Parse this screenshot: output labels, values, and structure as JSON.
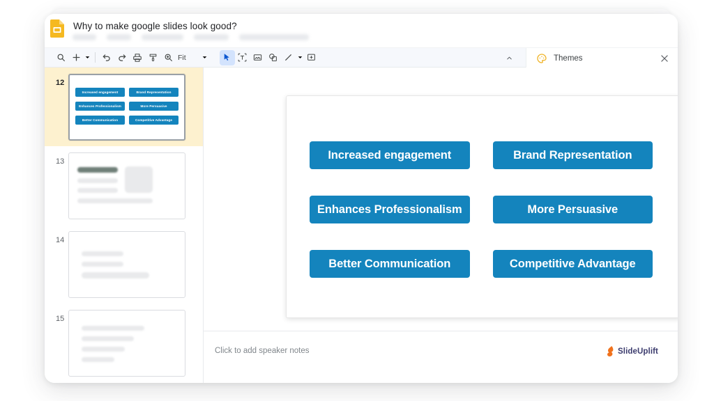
{
  "app": {
    "logo_icon": "google-slides-icon",
    "doc_title": "Why to make google slides look good?",
    "menu_placeholder_count": 5
  },
  "toolbar": {
    "items": [
      {
        "icon": "search-icon",
        "name": "search-tool"
      },
      {
        "icon": "plus-icon",
        "name": "new-slide-button"
      },
      {
        "icon": "caret-down-icon",
        "name": "new-slide-options-caret"
      },
      {
        "icon": "undo-icon",
        "name": "undo-button"
      },
      {
        "icon": "redo-icon",
        "name": "redo-button"
      },
      {
        "icon": "print-icon",
        "name": "print-button"
      },
      {
        "icon": "paint-format-icon",
        "name": "paint-format-button"
      },
      {
        "icon": "zoom-icon",
        "name": "zoom-button"
      }
    ],
    "fit_label": "Fit",
    "fit_caret_icon": "caret-down-icon",
    "tools": [
      {
        "icon": "cursor-icon",
        "name": "select-tool",
        "active": true
      },
      {
        "icon": "textbox-icon",
        "name": "text-box-tool",
        "active": false
      },
      {
        "icon": "image-icon",
        "name": "insert-image-tool",
        "active": false
      },
      {
        "icon": "shape-icon",
        "name": "insert-shape-tool",
        "active": false
      },
      {
        "icon": "line-icon",
        "name": "insert-line-tool",
        "active": false
      },
      {
        "icon": "caret-down-icon",
        "name": "line-options-caret",
        "active": false
      },
      {
        "icon": "comment-icon",
        "name": "add-comment-tool",
        "active": false
      }
    ],
    "collapse_icon": "chevron-up-icon"
  },
  "themes_panel": {
    "icon": "palette-icon",
    "title": "Themes",
    "close_icon": "close-icon"
  },
  "filmstrip": {
    "slides": [
      {
        "number": "12",
        "selected": true,
        "type": "buttons",
        "buttons": [
          "Increased engagement",
          "Brand Representation",
          "Enhances Professionalism",
          "More Persuasive",
          "Better Communication",
          "Competitive Advantage"
        ]
      },
      {
        "number": "13",
        "selected": false,
        "type": "placeholder-title-image"
      },
      {
        "number": "14",
        "selected": false,
        "type": "placeholder-lines-3"
      },
      {
        "number": "15",
        "selected": false,
        "type": "placeholder-lines-4"
      }
    ]
  },
  "slide": {
    "buttons": [
      "Increased engagement",
      "Brand Representation",
      "Enhances Professionalism",
      "More Persuasive",
      "Better Communication",
      "Competitive Advantage"
    ],
    "button_color": "#1484bd",
    "button_text_color": "#ffffff",
    "background": "#ffffff"
  },
  "notes": {
    "placeholder": "Click to add speaker notes"
  },
  "branding": {
    "mark_icon": "slideuplift-flame-icon",
    "name": "SlideUplift",
    "accent_color": "#f0721d",
    "text_color": "#3b3b6d"
  },
  "colors": {
    "selected_slide_bg": "#fdf1cf",
    "toolbar_bg": "#f6f8fc",
    "active_tool_bg": "#d3e3fd",
    "accent_blue": "#1484bd"
  }
}
